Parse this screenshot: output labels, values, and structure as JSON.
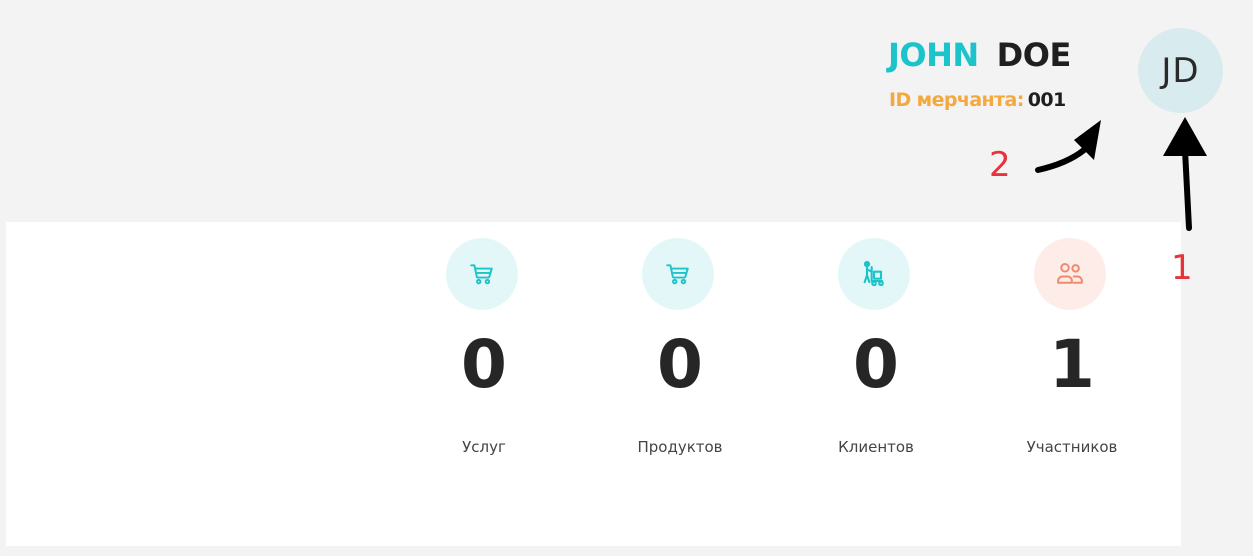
{
  "user": {
    "first_name": "JOHN",
    "last_name": "DOE",
    "merchant_label": "ID мерчанта:",
    "merchant_id": "001",
    "avatar_initials": "JD"
  },
  "stats": [
    {
      "value": "0",
      "label": "Услуг",
      "icon": "shopping-cart-icon"
    },
    {
      "value": "0",
      "label": "Продуктов",
      "icon": "shopping-cart-icon"
    },
    {
      "value": "0",
      "label": "Клиентов",
      "icon": "hand-truck-icon"
    },
    {
      "value": "1",
      "label": "Участников",
      "icon": "users-icon"
    }
  ],
  "annotations": {
    "one": "1",
    "two": "2"
  },
  "colors": {
    "accent_teal": "#1cc3cb",
    "accent_orange": "#f4a93f",
    "participants_icon": "#f08a6e",
    "annotation_red": "#e8323c"
  }
}
